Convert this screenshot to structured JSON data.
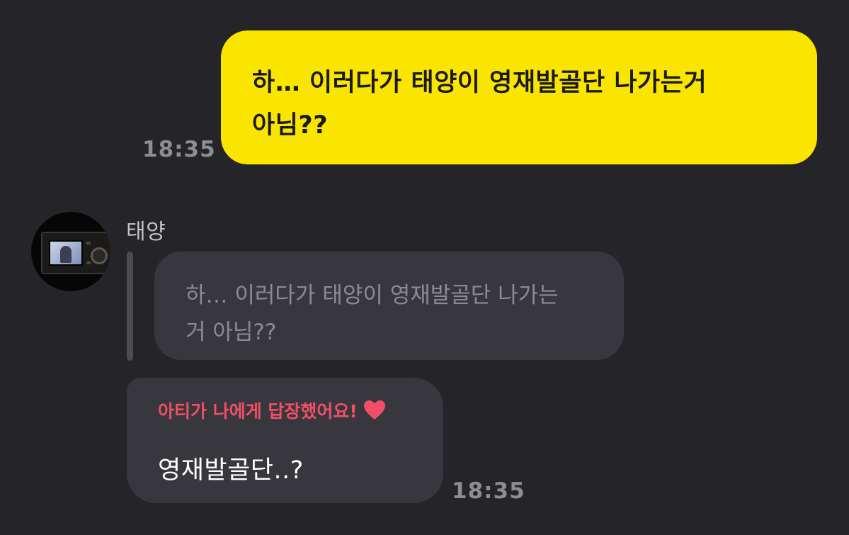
{
  "outgoing_message": {
    "lines": [
      "하… 이러다가 태양이 영재발골단 나가는거",
      "아님??"
    ],
    "time": "18:35"
  },
  "incoming": {
    "sender": "태양",
    "avatar_icon": "camera-photo-avatar",
    "quoted_message": {
      "lines": [
        "하… 이러다가 태양이 영재발골단 나가는",
        "거 아님??"
      ]
    },
    "reply": {
      "label": "아티가 나에게 답장했어요!",
      "label_icon": "heart-icon",
      "text": "영재발골단..?",
      "time": "18:35"
    }
  },
  "colors": {
    "background": "#252428",
    "outgoing_bubble": "#fae500",
    "incoming_bubble": "#38373d",
    "reply_accent": "#f04f67"
  }
}
